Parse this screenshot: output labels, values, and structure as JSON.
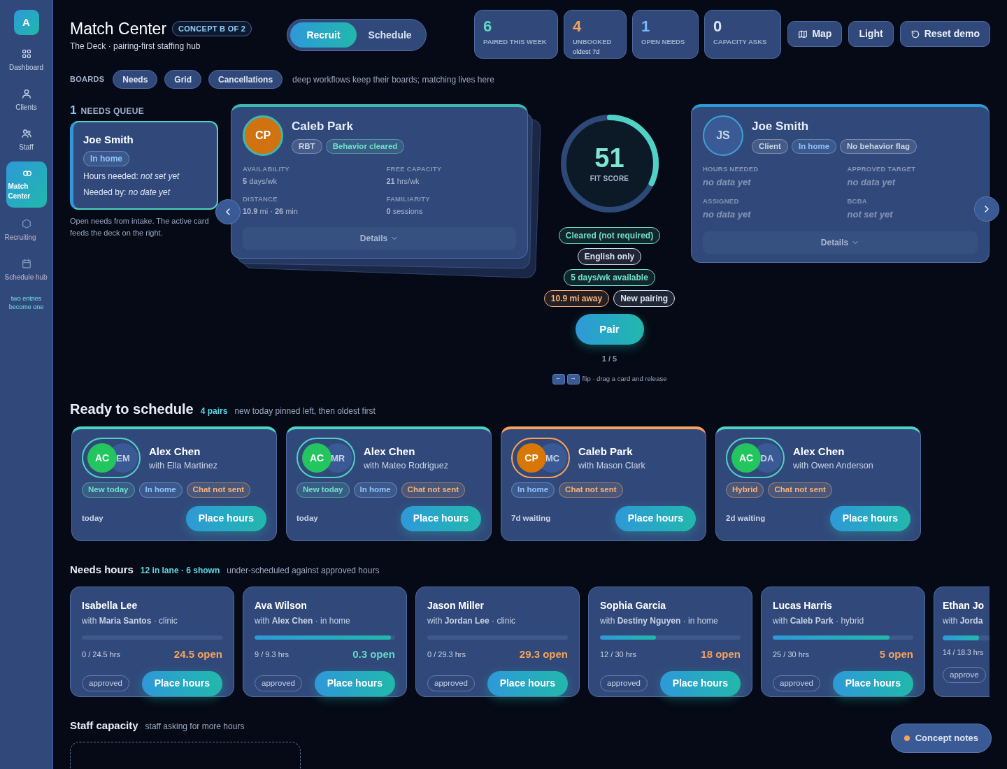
{
  "sidebar": {
    "logo": "A",
    "items": [
      {
        "label": "Dashboard",
        "selected": false,
        "disabled": false
      },
      {
        "label": "Clients",
        "selected": false,
        "disabled": false
      },
      {
        "label": "Staff",
        "selected": false,
        "disabled": false
      },
      {
        "label": "Match Center",
        "selected": true,
        "disabled": false
      },
      {
        "label": "Recruiting",
        "selected": false,
        "disabled": true
      },
      {
        "label": "Schedule hub",
        "selected": false,
        "disabled": true
      }
    ],
    "note": "two entries become one"
  },
  "header": {
    "title": "Match Center",
    "badge": "CONCEPT B OF 2",
    "subtitle": "The Deck · pairing-first staffing hub",
    "modes": [
      {
        "label": "Recruit",
        "selected": true
      },
      {
        "label": "Schedule",
        "selected": false
      }
    ],
    "stats": [
      {
        "value": "6",
        "label": "PAIRED THIS WEEK",
        "color": "#5fd8c6"
      },
      {
        "value": "4",
        "label": "UNBOOKED",
        "sub": "oldest 7d",
        "color": "#f6a25b"
      },
      {
        "value": "1",
        "label": "OPEN NEEDS",
        "color": "#7bb8ff"
      },
      {
        "value": "0",
        "label": "CAPACITY ASKS",
        "color": "#dbe4f3"
      }
    ],
    "actions": [
      "Map",
      "Light",
      "Reset demo"
    ]
  },
  "boards": {
    "label": "BOARDS",
    "chips": [
      "Needs",
      "Grid",
      "Cancellations"
    ],
    "note": "deep workflows keep their boards; matching lives here"
  },
  "queue": {
    "count": "1",
    "label": "NEEDS QUEUE",
    "cards": [
      {
        "name": "Joe Smith",
        "tag": "In home",
        "lines": [
          "Hours needed: *not set yet*",
          "Needed by: *no date yet*"
        ],
        "selected": true
      }
    ],
    "note": "Open needs from intake. The active card feeds the deck on the right."
  },
  "staff_card": {
    "initials": "CP",
    "name": "Caleb Park",
    "tags": [
      {
        "label": "RBT",
        "color": "#c8d3e6"
      },
      {
        "label": "Behavior cleared",
        "color": "#6ee0cc"
      }
    ],
    "fields": [
      {
        "label": "AVAILABILITY",
        "value": "**5** days/wk"
      },
      {
        "label": "FREE CAPACITY",
        "value": "**21** hrs/wk"
      },
      {
        "label": "DISTANCE",
        "value": "**10.9** mi · **26** min"
      },
      {
        "label": "FAMILIARITY",
        "value": "**0** sessions"
      }
    ],
    "details": "Details"
  },
  "fit": {
    "score": "51",
    "label": "FIT SCORE",
    "level": 0.32,
    "chips": [
      [
        {
          "label": "Cleared (not required)",
          "color": "#6ee0cc"
        }
      ],
      [
        {
          "label": "English only",
          "color": "#d6e2f5"
        }
      ],
      [
        {
          "label": "5 days/wk available",
          "color": "#6ee0cc"
        }
      ],
      [
        {
          "label": "10.9 mi away",
          "color": "#f6b27a"
        },
        {
          "label": "New pairing",
          "color": "#d6e2f5"
        }
      ]
    ],
    "action": "Pair",
    "position": "1 / 5",
    "keys": [
      "←",
      "→"
    ],
    "hint": "flip · drag a card and release"
  },
  "client_card": {
    "initials": "JS",
    "name": "Joe Smith",
    "tags": [
      {
        "label": "Client",
        "color": "#c8d3e6"
      },
      {
        "label": "In home",
        "color": "#8cc4ff"
      },
      {
        "label": "No behavior flag",
        "color": "#c8d3e6"
      }
    ],
    "fields": [
      {
        "label": "HOURS NEEDED",
        "value": "no data yet"
      },
      {
        "label": "APPROVED TARGET",
        "value": "no data yet"
      },
      {
        "label": "ASSIGNED",
        "value": "no data yet"
      },
      {
        "label": "BCBA",
        "value": "not set yet"
      }
    ],
    "details": "Details"
  },
  "ready": {
    "title": "Ready to schedule",
    "count": "4 pairs",
    "note": "new today pinned left, then oldest first",
    "pairs": [
      {
        "color": "#4fd1c5",
        "a": {
          "initials": "AC",
          "color": "#22c55e"
        },
        "b": "EM",
        "name": "Alex Chen",
        "with": "with Ella Martinez",
        "tags": [
          {
            "label": "New today",
            "color": "#6ee0cc"
          },
          {
            "label": "In home",
            "color": "#8cc4ff"
          },
          {
            "label": "Chat not sent",
            "color": "#f6b27a"
          }
        ],
        "age": "today",
        "action": "Place hours"
      },
      {
        "color": "#4fd1c5",
        "a": {
          "initials": "AC",
          "color": "#22c55e"
        },
        "b": "MR",
        "name": "Alex Chen",
        "with": "with Mateo Rodriguez",
        "tags": [
          {
            "label": "New today",
            "color": "#6ee0cc"
          },
          {
            "label": "In home",
            "color": "#8cc4ff"
          },
          {
            "label": "Chat not sent",
            "color": "#f6b27a"
          }
        ],
        "age": "today",
        "action": "Place hours"
      },
      {
        "color": "#f6a25b",
        "a": {
          "initials": "CP",
          "color": "#d97706"
        },
        "b": "MC",
        "name": "Caleb Park",
        "with": "with Mason Clark",
        "tags": [
          {
            "label": "In home",
            "color": "#8cc4ff"
          },
          {
            "label": "Chat not sent",
            "color": "#f6b27a"
          }
        ],
        "age": "7d waiting",
        "action": "Place hours"
      },
      {
        "color": "#4fd1c5",
        "a": {
          "initials": "AC",
          "color": "#22c55e"
        },
        "b": "DA",
        "name": "Alex Chen",
        "with": "with Owen Anderson",
        "tags": [
          {
            "label": "Hybrid",
            "color": "#f6b27a"
          },
          {
            "label": "Chat not sent",
            "color": "#f6b27a"
          }
        ],
        "age": "2d waiting",
        "action": "Place hours"
      }
    ]
  },
  "needs_hours": {
    "title": "Needs hours",
    "count": "12 in lane · 6 shown",
    "note": "under-scheduled against approved hours",
    "cards": [
      {
        "name": "Isabella Lee",
        "with": "with **Maria Santos** · clinic",
        "level": 0,
        "hours": "0 / 24.5 hrs",
        "open": "24.5 open",
        "color": "#f6a25b",
        "badge": "approved",
        "action": "Place hours"
      },
      {
        "name": "Ava Wilson",
        "with": "with **Alex Chen** · in home",
        "level": 0.97,
        "hours": "9 / 9.3 hrs",
        "open": "0.3 open",
        "color": "#5fd8c6",
        "badge": "approved",
        "action": "Place hours"
      },
      {
        "name": "Jason Miller",
        "with": "with **Jordan Lee** · clinic",
        "level": 0,
        "hours": "0 / 29.3 hrs",
        "open": "29.3 open",
        "color": "#f6a25b",
        "badge": "approved",
        "action": "Place hours"
      },
      {
        "name": "Sophia Garcia",
        "with": "with **Destiny Nguyen** · in home",
        "level": 0.4,
        "hours": "12 / 30 hrs",
        "open": "18 open",
        "color": "#f6a25b",
        "badge": "approved",
        "action": "Place hours"
      },
      {
        "name": "Lucas Harris",
        "with": "with **Caleb Park** · hybrid",
        "level": 0.83,
        "hours": "25 / 30 hrs",
        "open": "5 open",
        "color": "#f6a25b",
        "badge": "approved",
        "action": "Place hours"
      },
      {
        "name": "Ethan Jo",
        "with": "with **Jorda**",
        "level": 0.77,
        "hours": "14 / 18.3 hrs",
        "badge": "approve"
      }
    ]
  },
  "capacity": {
    "title": "Staff capacity",
    "note": "staff asking for more hours"
  },
  "notes_button": "Concept notes"
}
